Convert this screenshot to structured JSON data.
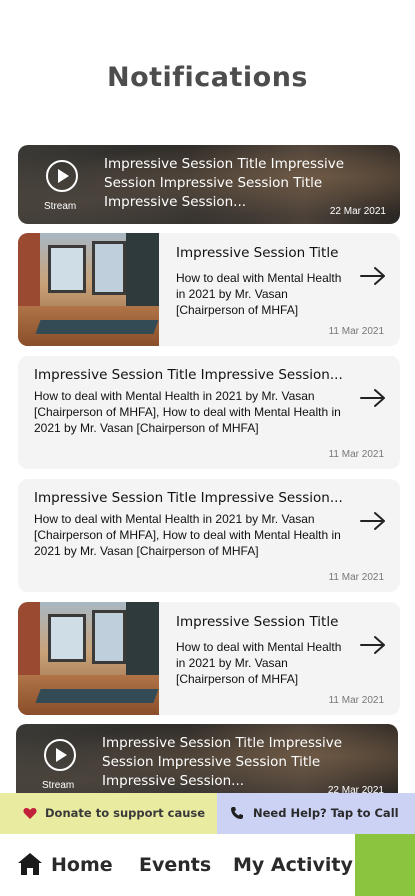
{
  "page": {
    "title": "Notifications"
  },
  "stream_card_1": {
    "label": "Stream",
    "title": "Impressive Session Title Impressive Session Impressive Session Title Impressive Session...",
    "date": "22 Mar 2021"
  },
  "card_1": {
    "title": "Impressive Session Title",
    "desc": "How to deal with Mental Health in 2021 by Mr. Vasan [Chairperson of MHFA]",
    "date": "11 Mar 2021"
  },
  "card_2": {
    "title": "Impressive Session Title Impressive Session...",
    "desc": "How to deal with Mental Health in 2021 by Mr. Vasan [Chairperson of MHFA], How to deal with Mental Health in 2021 by Mr. Vasan [Chairperson of MHFA]",
    "date": "11 Mar 2021"
  },
  "card_3": {
    "title": "Impressive Session Title Impressive Session...",
    "desc": "How to deal with Mental Health in 2021 by Mr. Vasan [Chairperson of MHFA], How to deal with Mental Health in 2021 by Mr. Vasan [Chairperson of MHFA]",
    "date": "11 Mar 2021"
  },
  "card_4": {
    "title": "Impressive Session Title",
    "desc": "How to deal with Mental Health in 2021 by Mr. Vasan [Chairperson of MHFA]",
    "date": "11 Mar 2021"
  },
  "stream_card_2": {
    "label": "Stream",
    "title": "Impressive Session Title Impressive Session Impressive Session Title Impressive Session...",
    "date": "22 Mar 2021"
  },
  "help_bar": {
    "donate_label": "Donate to support cause",
    "call_label": "Need Help? Tap to Call"
  },
  "nav": {
    "home": "Home",
    "events": "Events",
    "activity": "My Activity"
  },
  "colors": {
    "donate_bg": "#e8eba0",
    "call_bg": "#ccd2f4",
    "accent_green": "#8bc53f",
    "heart": "#c0203a"
  },
  "icons": [
    "play-icon",
    "arrow-right-icon",
    "heart-icon",
    "phone-icon",
    "home-icon"
  ]
}
